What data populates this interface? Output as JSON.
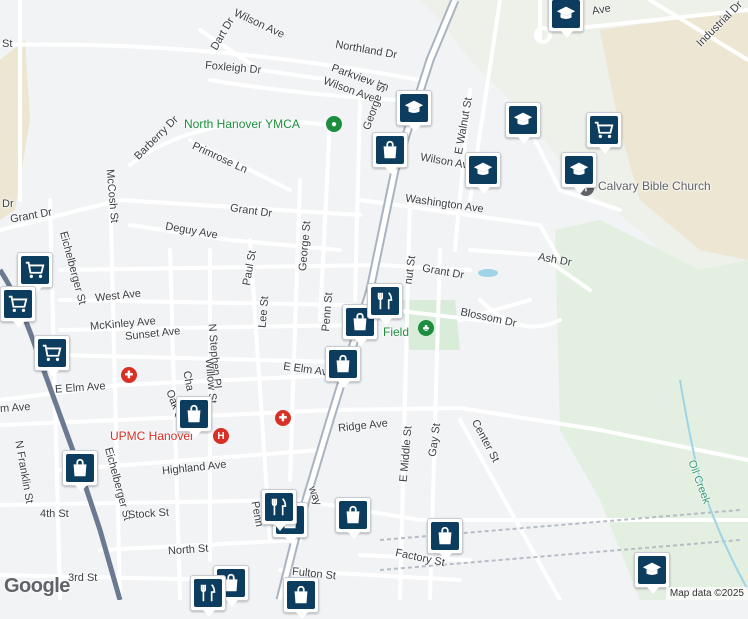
{
  "streets": {
    "wilson_ave_top": "Wilson Ave",
    "dart_dr": "Dart Dr",
    "northland_dr": "Northland Dr",
    "foxleigh_dr": "Foxleigh Dr",
    "parkview_ln": "Parkview Ln",
    "wilson_ave_2": "Wilson Ave",
    "george_st_top": "George St",
    "e_walnut_st": "E Walnut St",
    "barberry_dr": "Barberry Dr",
    "primrose_ln": "Primrose Ln",
    "mccosh_st": "McCosh St",
    "wilson_ave_3": "Wilson Ave",
    "washington_ave": "Washington Ave",
    "grant_dr_left": "Grant Dr",
    "grant_dr_mid": "Grant Dr",
    "deguy_ave": "Deguy Ave",
    "george_st": "George St",
    "paul_st": "Paul St",
    "ash_dr": "Ash Dr",
    "grant_dr_right": "Grant Dr",
    "walnut_st_short": "nut St",
    "eichelberger_st_top": "Eichelberger St",
    "west_ave": "West Ave",
    "lee_st": "Lee St",
    "penn_st": "Penn St",
    "mckinley_ave": "McKinley Ave",
    "blossom_dr": "Blossom Dr",
    "sunset_ave": "Sunset Ave",
    "n_stephen_pl": "N Stephen Pl",
    "field_short": "Field",
    "e_elm_ave_mid": "E Elm Ave",
    "willow_st": "Willow St",
    "e_elm_ave_left": "E Elm Ave",
    "cha_short": "Cha",
    "m_ave": "m Ave",
    "oak_st": "Oak St",
    "ridge_ave": "Ridge Ave",
    "e_middle_st": "E Middle St",
    "gay_st": "Gay St",
    "center_st": "Center St",
    "n_franklin_st": "N Franklin St",
    "highland_ave": "Highland Ave",
    "eichelberger_st_bottom": "Eichelberger St",
    "stock_st": "Stock St",
    "fourth_st": "4th St",
    "way_short": "way",
    "north_st": "North St",
    "factory_st": "Factory St",
    "fulton_st": "Fulton St",
    "third_st": "3rd St",
    "penn_short": "Penn",
    "industrial_dr": "Industrial Dr",
    "oil_creek": "Oil Creek",
    "st_left": "St",
    "dr_left": "Dr",
    "ave_top": "Ave"
  },
  "pois": {
    "ymca": "North Hanover YMCA",
    "calvary": "Calvary Bible Church",
    "upmc": "UPMC Hanover"
  },
  "markers": [
    {
      "type": "school",
      "icon": "graduation-cap-icon"
    },
    {
      "type": "school",
      "icon": "graduation-cap-icon"
    },
    {
      "type": "school",
      "icon": "graduation-cap-icon"
    },
    {
      "type": "school",
      "icon": "graduation-cap-icon"
    },
    {
      "type": "school",
      "icon": "graduation-cap-icon"
    },
    {
      "type": "school",
      "icon": "graduation-cap-icon"
    },
    {
      "type": "grocery",
      "icon": "shopping-cart-icon"
    },
    {
      "type": "grocery",
      "icon": "shopping-cart-icon"
    },
    {
      "type": "grocery",
      "icon": "shopping-cart-icon"
    },
    {
      "type": "grocery",
      "icon": "shopping-cart-icon"
    },
    {
      "type": "shopping",
      "icon": "shopping-bag-icon"
    },
    {
      "type": "shopping",
      "icon": "shopping-bag-icon"
    },
    {
      "type": "shopping",
      "icon": "shopping-bag-icon"
    },
    {
      "type": "shopping",
      "icon": "shopping-bag-icon"
    },
    {
      "type": "shopping",
      "icon": "shopping-bag-icon"
    },
    {
      "type": "shopping",
      "icon": "shopping-bag-icon"
    },
    {
      "type": "shopping",
      "icon": "shopping-bag-icon"
    },
    {
      "type": "shopping",
      "icon": "shopping-bag-icon"
    },
    {
      "type": "shopping",
      "icon": "shopping-bag-icon"
    },
    {
      "type": "shopping",
      "icon": "shopping-bag-icon"
    },
    {
      "type": "restaurant",
      "icon": "fork-knife-icon"
    },
    {
      "type": "restaurant",
      "icon": "fork-knife-icon"
    },
    {
      "type": "restaurant",
      "icon": "fork-knife-icon"
    }
  ],
  "attribution": "Map data ©2025",
  "logo": "Google",
  "colors": {
    "background": "#f1f3f5",
    "road": "#ffffff",
    "highway": "#aab4c0",
    "railway": "#6b7a90",
    "park": "#cfe8d2",
    "industrial": "#ece6d2",
    "marker": "#0c3c5e",
    "poi_green": "#1e8e3e",
    "poi_red": "#d93025",
    "water": "#9fd4e6"
  }
}
